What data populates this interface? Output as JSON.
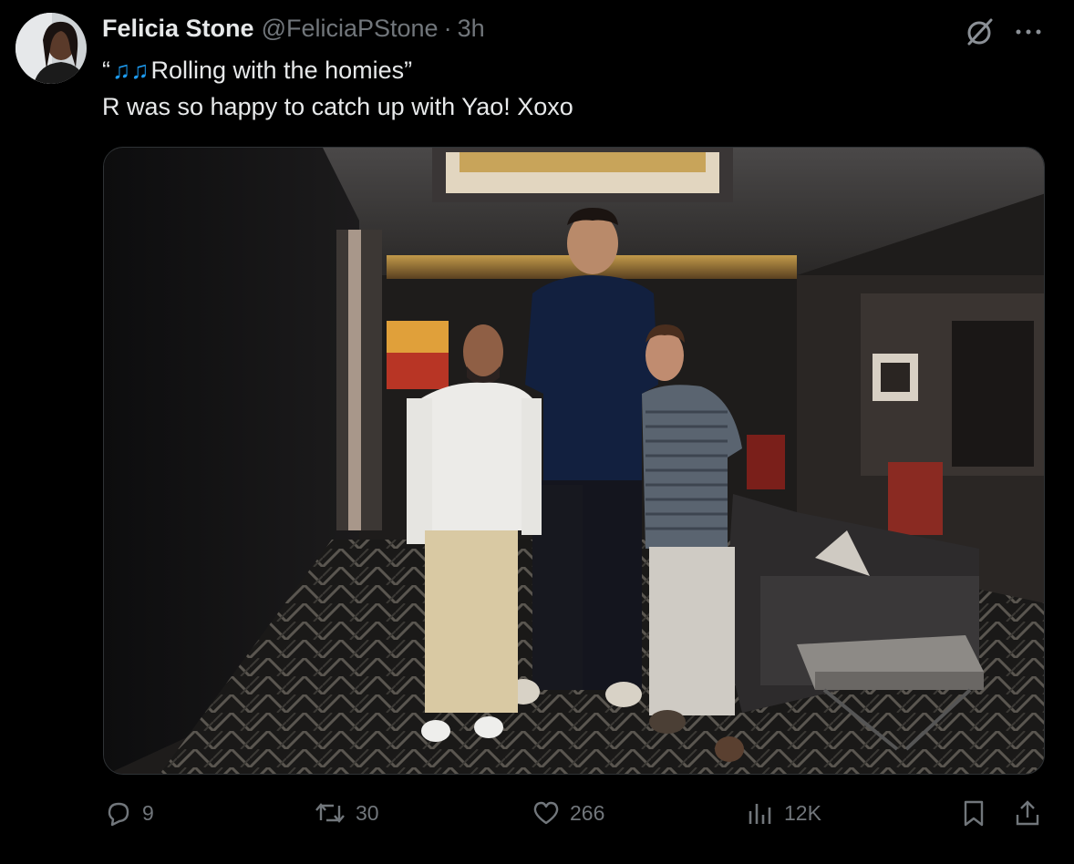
{
  "post": {
    "author_name": "Felicia Stone",
    "author_handle": "@FeliciaPStone",
    "separator": "·",
    "time": "3h",
    "line1_open": "“",
    "line1_note": "♫♫",
    "line1_text": "Rolling with the homies”",
    "line2": "R was so happy to catch up with Yao! Xoxo"
  },
  "actions": {
    "replies": "9",
    "reposts": "30",
    "likes": "266",
    "views": "12K"
  },
  "icons": [
    "grok-icon",
    "more-icon",
    "reply-icon",
    "repost-icon",
    "like-icon",
    "views-icon",
    "bookmark-icon",
    "share-icon"
  ],
  "colors": {
    "background": "#000000",
    "text": "#e7e9ea",
    "muted": "#71767b",
    "accent": "#1d9bf0"
  }
}
